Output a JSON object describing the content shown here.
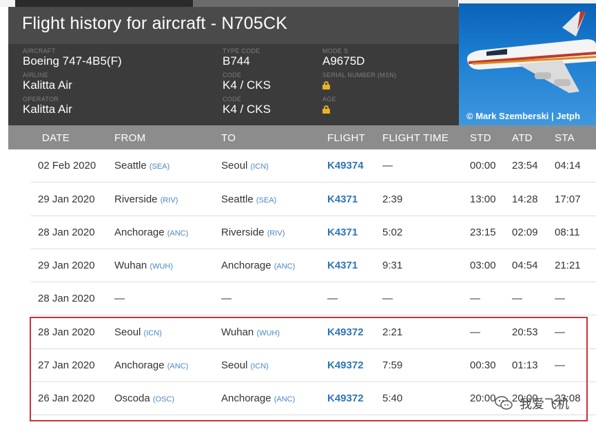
{
  "page": {
    "title": "Flight history for aircraft - N705CK"
  },
  "aircraft_info": {
    "aircraft": {
      "label": "AIRCRAFT",
      "value": "Boeing 747-4B5(F)"
    },
    "airline": {
      "label": "AIRLINE",
      "value": "Kalitta Air"
    },
    "operator": {
      "label": "OPERATOR",
      "value": "Kalitta Air"
    },
    "type_code": {
      "label": "TYPE CODE",
      "value": "B744"
    },
    "code1": {
      "label": "Code",
      "value": "K4 / CKS"
    },
    "code2": {
      "label": "Code",
      "value": "K4 / CKS"
    },
    "mode_s": {
      "label": "MODE S",
      "value": "A9675D"
    },
    "serial": {
      "label": "SERIAL NUMBER (MSN)",
      "locked": true
    },
    "age": {
      "label": "AGE",
      "locked": true
    }
  },
  "photo": {
    "credit": "© Mark Szemberski | Jetph"
  },
  "table": {
    "columns": [
      "DATE",
      "FROM",
      "TO",
      "FLIGHT",
      "FLIGHT TIME",
      "STD",
      "ATD",
      "STA"
    ],
    "rows": [
      {
        "date": "02 Feb 2020",
        "from": "Seattle",
        "from_code": "(SEA)",
        "to": "Seoul",
        "to_code": "(ICN)",
        "flight": "K49374",
        "flight_time": "—",
        "std": "00:00",
        "atd": "23:54",
        "sta": "04:14"
      },
      {
        "date": "29 Jan 2020",
        "from": "Riverside",
        "from_code": "(RIV)",
        "to": "Seattle",
        "to_code": "(SEA)",
        "flight": "K4371",
        "flight_time": "2:39",
        "std": "13:00",
        "atd": "14:28",
        "sta": "17:07"
      },
      {
        "date": "28 Jan 2020",
        "from": "Anchorage",
        "from_code": "(ANC)",
        "to": "Riverside",
        "to_code": "(RIV)",
        "flight": "K4371",
        "flight_time": "5:02",
        "std": "23:15",
        "atd": "02:09",
        "sta": "08:11"
      },
      {
        "date": "29 Jan 2020",
        "from": "Wuhan",
        "from_code": "(WUH)",
        "to": "Anchorage",
        "to_code": "(ANC)",
        "flight": "K4371",
        "flight_time": "9:31",
        "std": "03:00",
        "atd": "04:54",
        "sta": "21:21"
      },
      {
        "date": "28 Jan 2020",
        "from": "—",
        "from_code": "",
        "to": "—",
        "to_code": "",
        "flight": "—",
        "flight_time": "—",
        "std": "—",
        "atd": "—",
        "sta": "—"
      },
      {
        "date": "28 Jan 2020",
        "from": "Seoul",
        "from_code": "(ICN)",
        "to": "Wuhan",
        "to_code": "(WUH)",
        "flight": "K49372",
        "flight_time": "2:21",
        "std": "—",
        "atd": "20:53",
        "sta": "—"
      },
      {
        "date": "27 Jan 2020",
        "from": "Anchorage",
        "from_code": "(ANC)",
        "to": "Seoul",
        "to_code": "(ICN)",
        "flight": "K49372",
        "flight_time": "7:59",
        "std": "00:30",
        "atd": "01:13",
        "sta": "—"
      },
      {
        "date": "26 Jan 2020",
        "from": "Oscoda",
        "from_code": "(OSC)",
        "to": "Anchorage",
        "to_code": "(ANC)",
        "flight": "K49372",
        "flight_time": "5:40",
        "std": "20:00",
        "atd": "20:00",
        "sta": "23:08"
      }
    ]
  },
  "watermark": {
    "text": "我爱飞机",
    "icon": "wechat-icon"
  },
  "colors": {
    "flight_link": "#2e75b6",
    "highlight_border": "#c9323a",
    "lock": "#e6b422"
  }
}
